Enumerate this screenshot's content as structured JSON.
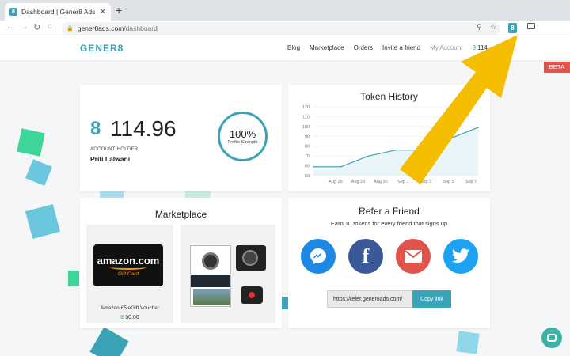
{
  "browser": {
    "tab_title": "Dashboard | Gener8 Ads",
    "tab_favicon": "8",
    "url_domain": "gener8ads.com",
    "url_path": "/dashboard",
    "extension_icon": "8"
  },
  "site": {
    "logo": "GENER8",
    "nav": [
      "Blog",
      "Marketplace",
      "Orders",
      "Invite a friend",
      "My Account"
    ],
    "nav_balance": "114",
    "beta": "BETA"
  },
  "balance_card": {
    "token_icon": "8",
    "amount": "114.96",
    "holder_label": "ACCOUNT HOLDER",
    "holder_name": "Priti Lalwani",
    "profile_strength_value": "100%",
    "profile_strength_label": "Profile Strength"
  },
  "token_history": {
    "title": "Token History"
  },
  "chart_data": {
    "type": "area",
    "title": "Token History",
    "x": [
      "Aug 26",
      "Aug 28",
      "Aug 30",
      "Sep 1",
      "Sep 3",
      "Sep 5",
      "Sep 7"
    ],
    "values": [
      59,
      59,
      70,
      76,
      76,
      88,
      99
    ],
    "ylim": [
      50,
      120
    ],
    "yticks": [
      50,
      60,
      70,
      80,
      90,
      100,
      110,
      120
    ],
    "grid": true
  },
  "marketplace": {
    "title": "Marketplace",
    "products": [
      {
        "brand": "amazon.com",
        "subtitle": "Gift Card",
        "name": "Amazon £5 eGift Voucher",
        "price": "50.00"
      },
      {
        "name": "",
        "price": ""
      }
    ]
  },
  "refer": {
    "title": "Refer a Friend",
    "subtitle": "Earn 10 tokens for every friend that signs up",
    "link": "https://refer.gener8ads.com/",
    "copy_label": "Copy link"
  },
  "colors": {
    "brand": "#3ba3b6",
    "arrow": "#f5bd00",
    "beta": "#e1544c"
  }
}
